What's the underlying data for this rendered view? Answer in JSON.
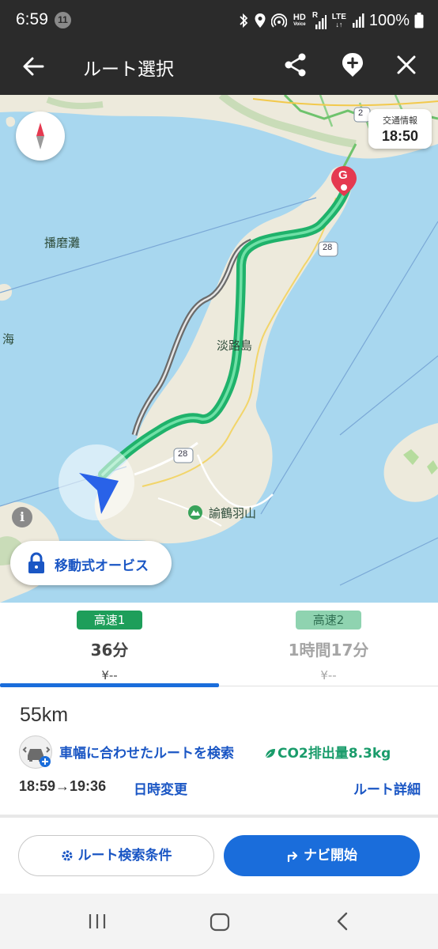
{
  "status_bar": {
    "time": "6:59",
    "notification_count": "11",
    "battery": "100%",
    "hd_label": "HD",
    "voice_label": "Voice",
    "r_label": "R",
    "lte_label": "LTE"
  },
  "app_bar": {
    "title": "ルート選択"
  },
  "map": {
    "traffic_info_label": "交通情報",
    "traffic_info_time": "18:50",
    "labels": {
      "harima_sea": "播磨灘",
      "sea_partial": "海",
      "awaji_island": "淡路島",
      "mountain": "諭鶴羽山"
    },
    "route_shields": [
      "2",
      "28",
      "28"
    ],
    "goal_marker": "G",
    "mobile_orbis_label": "移動式オービス"
  },
  "route_tabs": [
    {
      "badge": "高速1",
      "duration": "36分",
      "fare": "¥--",
      "selected": true,
      "badge_color": "#1e9e5a"
    },
    {
      "badge": "高速2",
      "duration": "1時間17分",
      "fare": "¥--",
      "selected": false,
      "badge_color": "#8fd3b0"
    }
  ],
  "details": {
    "distance": "55km",
    "vehicle_width_search": "車幅に合わせたルートを検索",
    "co2": "CO2排出量8.3kg",
    "times": "18:59→19:36",
    "change_time": "日時変更",
    "route_detail": "ルート詳細"
  },
  "actions": {
    "search_conditions": "ルート検索条件",
    "start_navigation": "ナビ開始"
  },
  "colors": {
    "accent_blue": "#1a6ddb",
    "link_blue": "#1a56c4",
    "route_green": "#1fb26b",
    "eco_green": "#1a9c6b",
    "goal_red": "#e53950"
  }
}
